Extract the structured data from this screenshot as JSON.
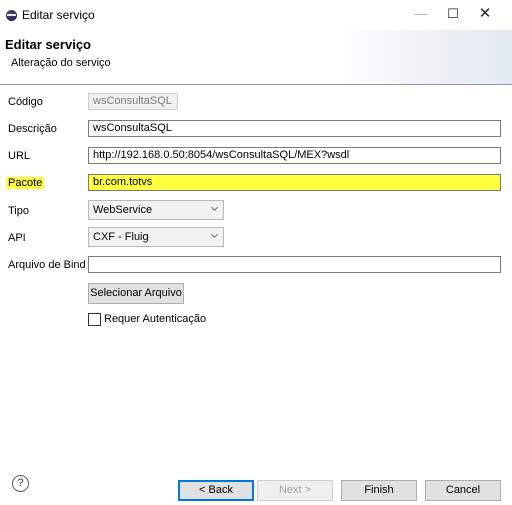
{
  "window": {
    "title": "Editar serviço",
    "minimize": "—",
    "maximize": "☐",
    "close": "✕"
  },
  "header": {
    "title": "Editar serviço",
    "subtitle": "Alteração do serviço"
  },
  "form": {
    "codigo": {
      "label": "Código",
      "value": "wsConsultaSQL"
    },
    "descricao": {
      "label": "Descrição",
      "value": "wsConsultaSQL"
    },
    "url": {
      "label": "URL",
      "value": "http://192.168.0.50:8054/wsConsultaSQL/MEX?wsdl"
    },
    "pacote": {
      "label": "Pacote",
      "value": "br.com.totvs"
    },
    "tipo": {
      "label": "Tipo",
      "value": "WebService"
    },
    "api": {
      "label": "API",
      "value": "CXF - Fluig"
    },
    "arquivo": {
      "label": "Arquivo de Bind",
      "value": ""
    },
    "selecionar_label": "Selecionar Arquivo",
    "requer_auth_label": "Requer Autenticação",
    "requer_auth_checked": false
  },
  "footer": {
    "help": "?",
    "back": "< Back",
    "next": "Next >",
    "finish": "Finish",
    "cancel": "Cancel"
  }
}
